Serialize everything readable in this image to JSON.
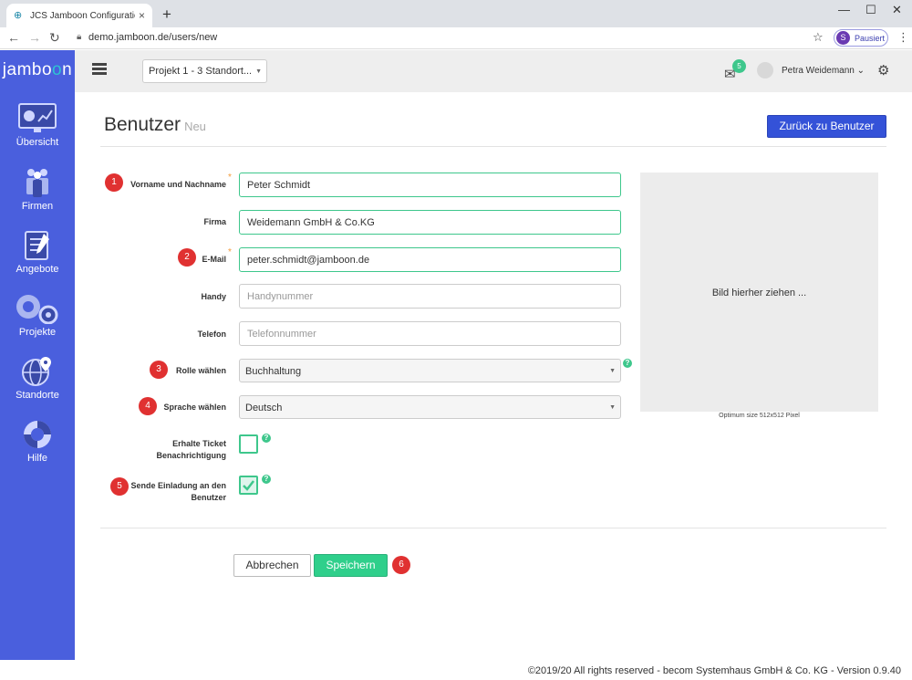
{
  "browser": {
    "tab_title": "JCS Jamboon Configuration Serv",
    "tab_close": "×",
    "new_tab": "+",
    "url": "demo.jamboon.de/users/new",
    "profile_initial": "S",
    "profile_status": "Pausiert"
  },
  "sidebar": {
    "logo_prefix": "jamb",
    "logo_o1": "o",
    "logo_o2": "o",
    "logo_suffix": "n",
    "items": [
      {
        "label": "Übersicht",
        "icon": "dashboard-icon"
      },
      {
        "label": "Firmen",
        "icon": "people-icon"
      },
      {
        "label": "Angebote",
        "icon": "document-icon"
      },
      {
        "label": "Projekte",
        "icon": "gears-icon"
      },
      {
        "label": "Standorte",
        "icon": "globe-pin-icon"
      },
      {
        "label": "Hilfe",
        "icon": "lifebuoy-icon"
      }
    ]
  },
  "header": {
    "project_select": "Projekt 1 - 3 Standort...",
    "mail_count": "5",
    "user_name": "Petra Weidemann"
  },
  "page": {
    "title": "Benutzer",
    "subtitle": "Neu",
    "back_button": "Zurück zu Benutzer"
  },
  "form": {
    "name": {
      "label": "Vorname und Nachname",
      "value": "Peter Schmidt",
      "step": "1"
    },
    "company": {
      "label": "Firma",
      "value": "Weidemann GmbH & Co.KG"
    },
    "email": {
      "label": "E-Mail",
      "value": "peter.schmidt@jamboon.de",
      "step": "2"
    },
    "mobile": {
      "label": "Handy",
      "placeholder": "Handynummer"
    },
    "phone": {
      "label": "Telefon",
      "placeholder": "Telefonnummer"
    },
    "role": {
      "label": "Rolle wählen",
      "value": "Buchhaltung",
      "step": "3"
    },
    "language": {
      "label": "Sprache wählen",
      "value": "Deutsch",
      "step": "4"
    },
    "ticket_notify": {
      "label_line1": "Erhalte Ticket",
      "label_line2": "Benachrichtigung",
      "checked": false
    },
    "send_invite": {
      "label_line1": "Sende Einladung an den",
      "label_line2": "Benutzer",
      "checked": true,
      "step": "5"
    },
    "required_mark": "*",
    "help_mark": "?"
  },
  "image_upload": {
    "drop_text": "Bild hierher ziehen ...",
    "hint": "Optimum size 512x512 Pixel"
  },
  "actions": {
    "cancel": "Abbrechen",
    "save": "Speichern",
    "step": "6"
  },
  "footer": {
    "text": "©2019/20 All rights reserved - becom Systemhaus GmbH & Co. KG - Version 0.9.40"
  },
  "colors": {
    "sidebar": "#4a5fdd",
    "accent_green": "#3ec78c",
    "primary_blue": "#3452d8",
    "step_red": "#e03131"
  }
}
